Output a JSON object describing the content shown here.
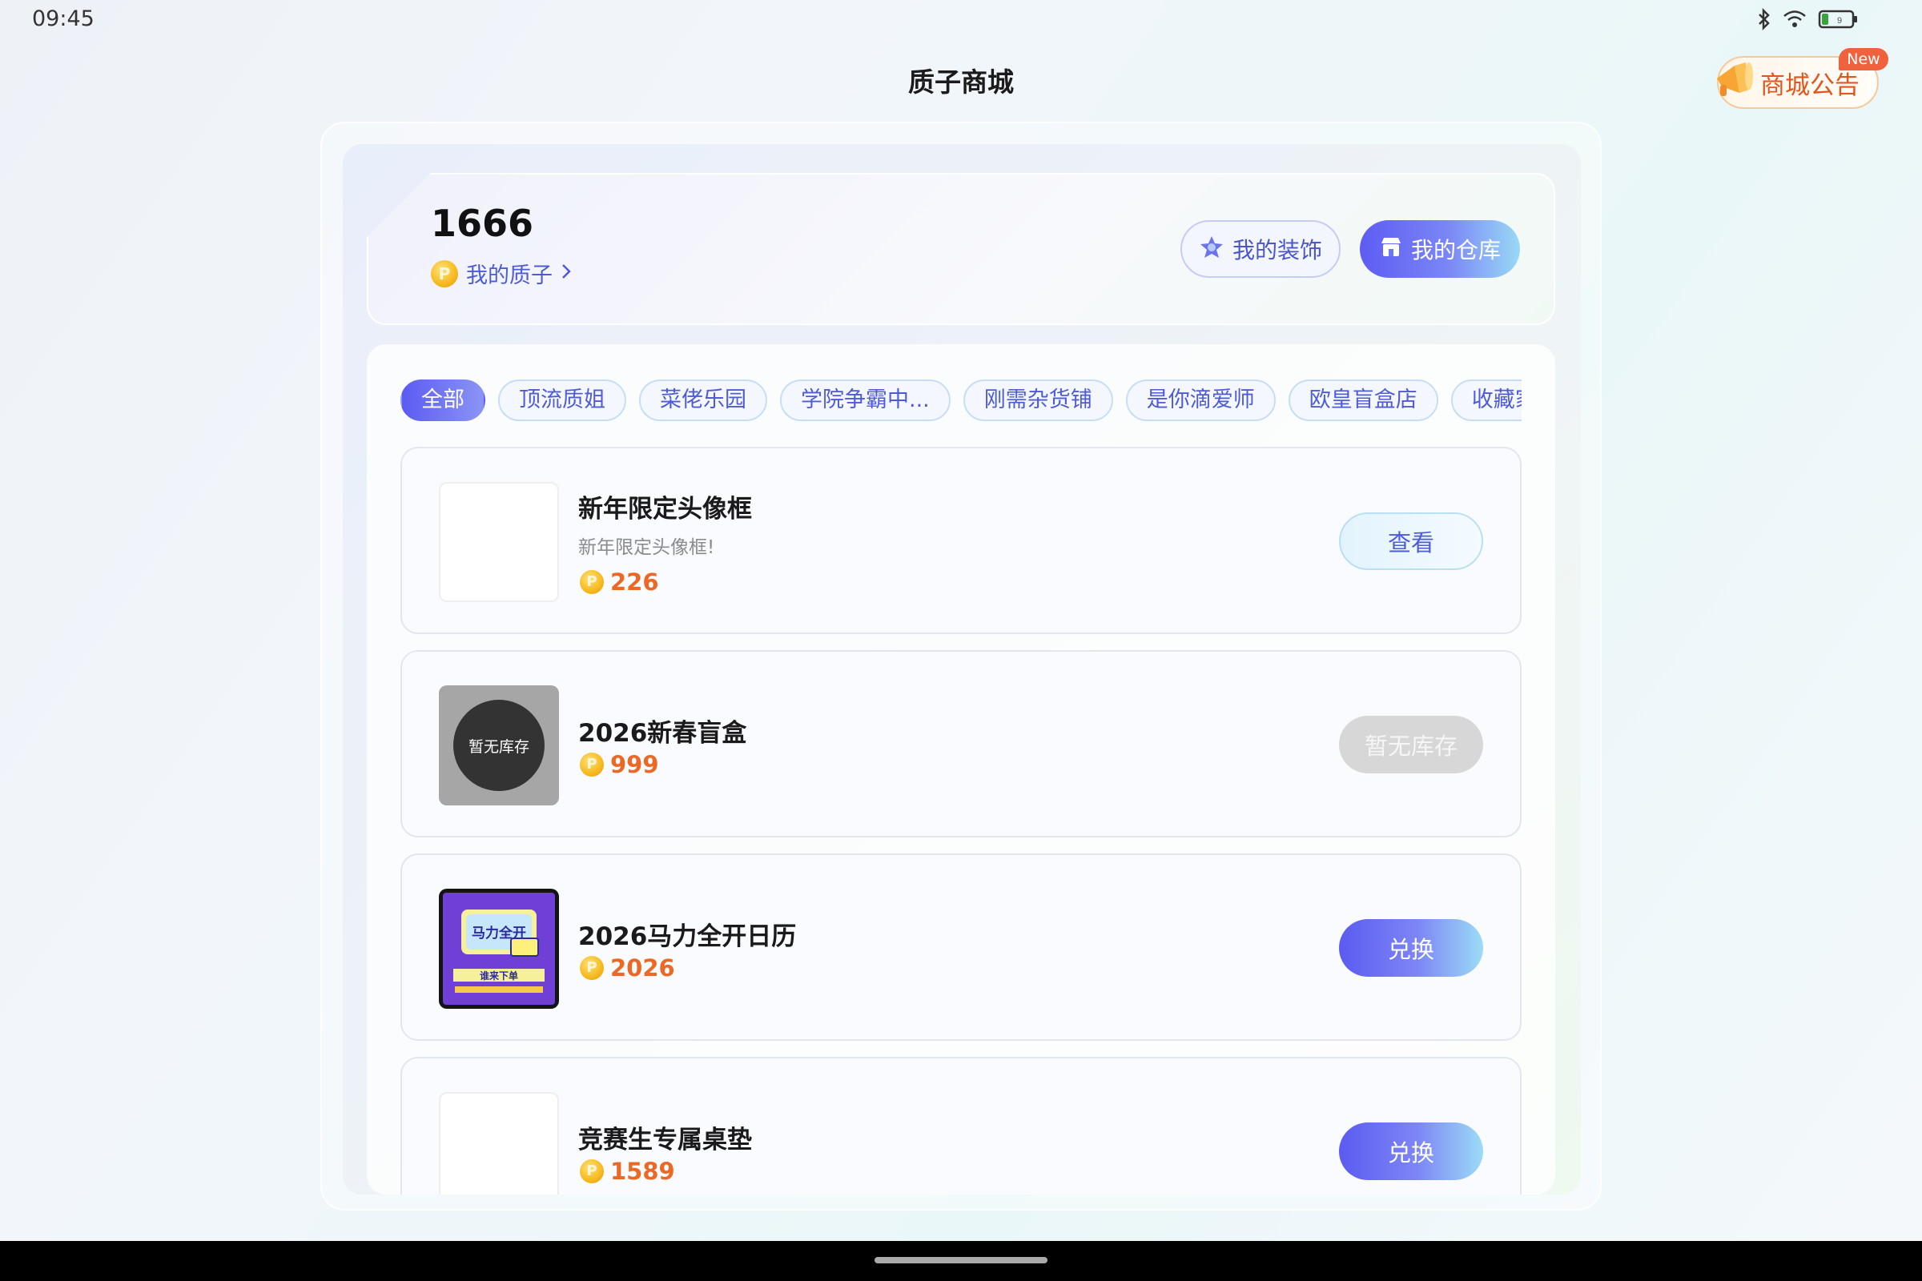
{
  "status_bar": {
    "time": "09:45",
    "battery_level": "9"
  },
  "header": {
    "title": "质子商城"
  },
  "announcement": {
    "label": "商城公告",
    "badge": "New"
  },
  "balance": {
    "value": "1666",
    "link_label": "我的质子"
  },
  "buttons": {
    "decorations": "我的装饰",
    "warehouse": "我的仓库"
  },
  "tabs": [
    {
      "label": "全部",
      "active": true
    },
    {
      "label": "顶流质姐",
      "active": false
    },
    {
      "label": "菜佬乐园",
      "active": false
    },
    {
      "label": "学院争霸中...",
      "active": false
    },
    {
      "label": "刚需杂货铺",
      "active": false
    },
    {
      "label": "是你滴爱师",
      "active": false
    },
    {
      "label": "欧皇盲盒店",
      "active": false
    },
    {
      "label": "收藏家基",
      "active": false
    }
  ],
  "products": [
    {
      "title": "新年限定头像框",
      "desc": "新年限定头像框!",
      "price": "226",
      "action": "查看"
    },
    {
      "title": "2026新春盲盒",
      "price": "999",
      "action": "暂无库存",
      "soldout_label": "暂无库存"
    },
    {
      "title": "2026马力全开日历",
      "price": "2026",
      "action": "兑换",
      "image_text": "马力全开",
      "image_subtext": "谁来下单"
    },
    {
      "title": "竞赛生专属桌垫",
      "price": "1589",
      "action": "兑换"
    }
  ],
  "colors": {
    "accent": "#5b5cf1",
    "price": "#ec6825",
    "announcement": "#e0561d",
    "new_badge": "#f0613d"
  },
  "icons": [
    "bluetooth-icon",
    "wifi-icon",
    "battery-icon",
    "megaphone-icon",
    "coin-icon",
    "chevron-right-icon",
    "star-badge-icon",
    "store-icon"
  ]
}
